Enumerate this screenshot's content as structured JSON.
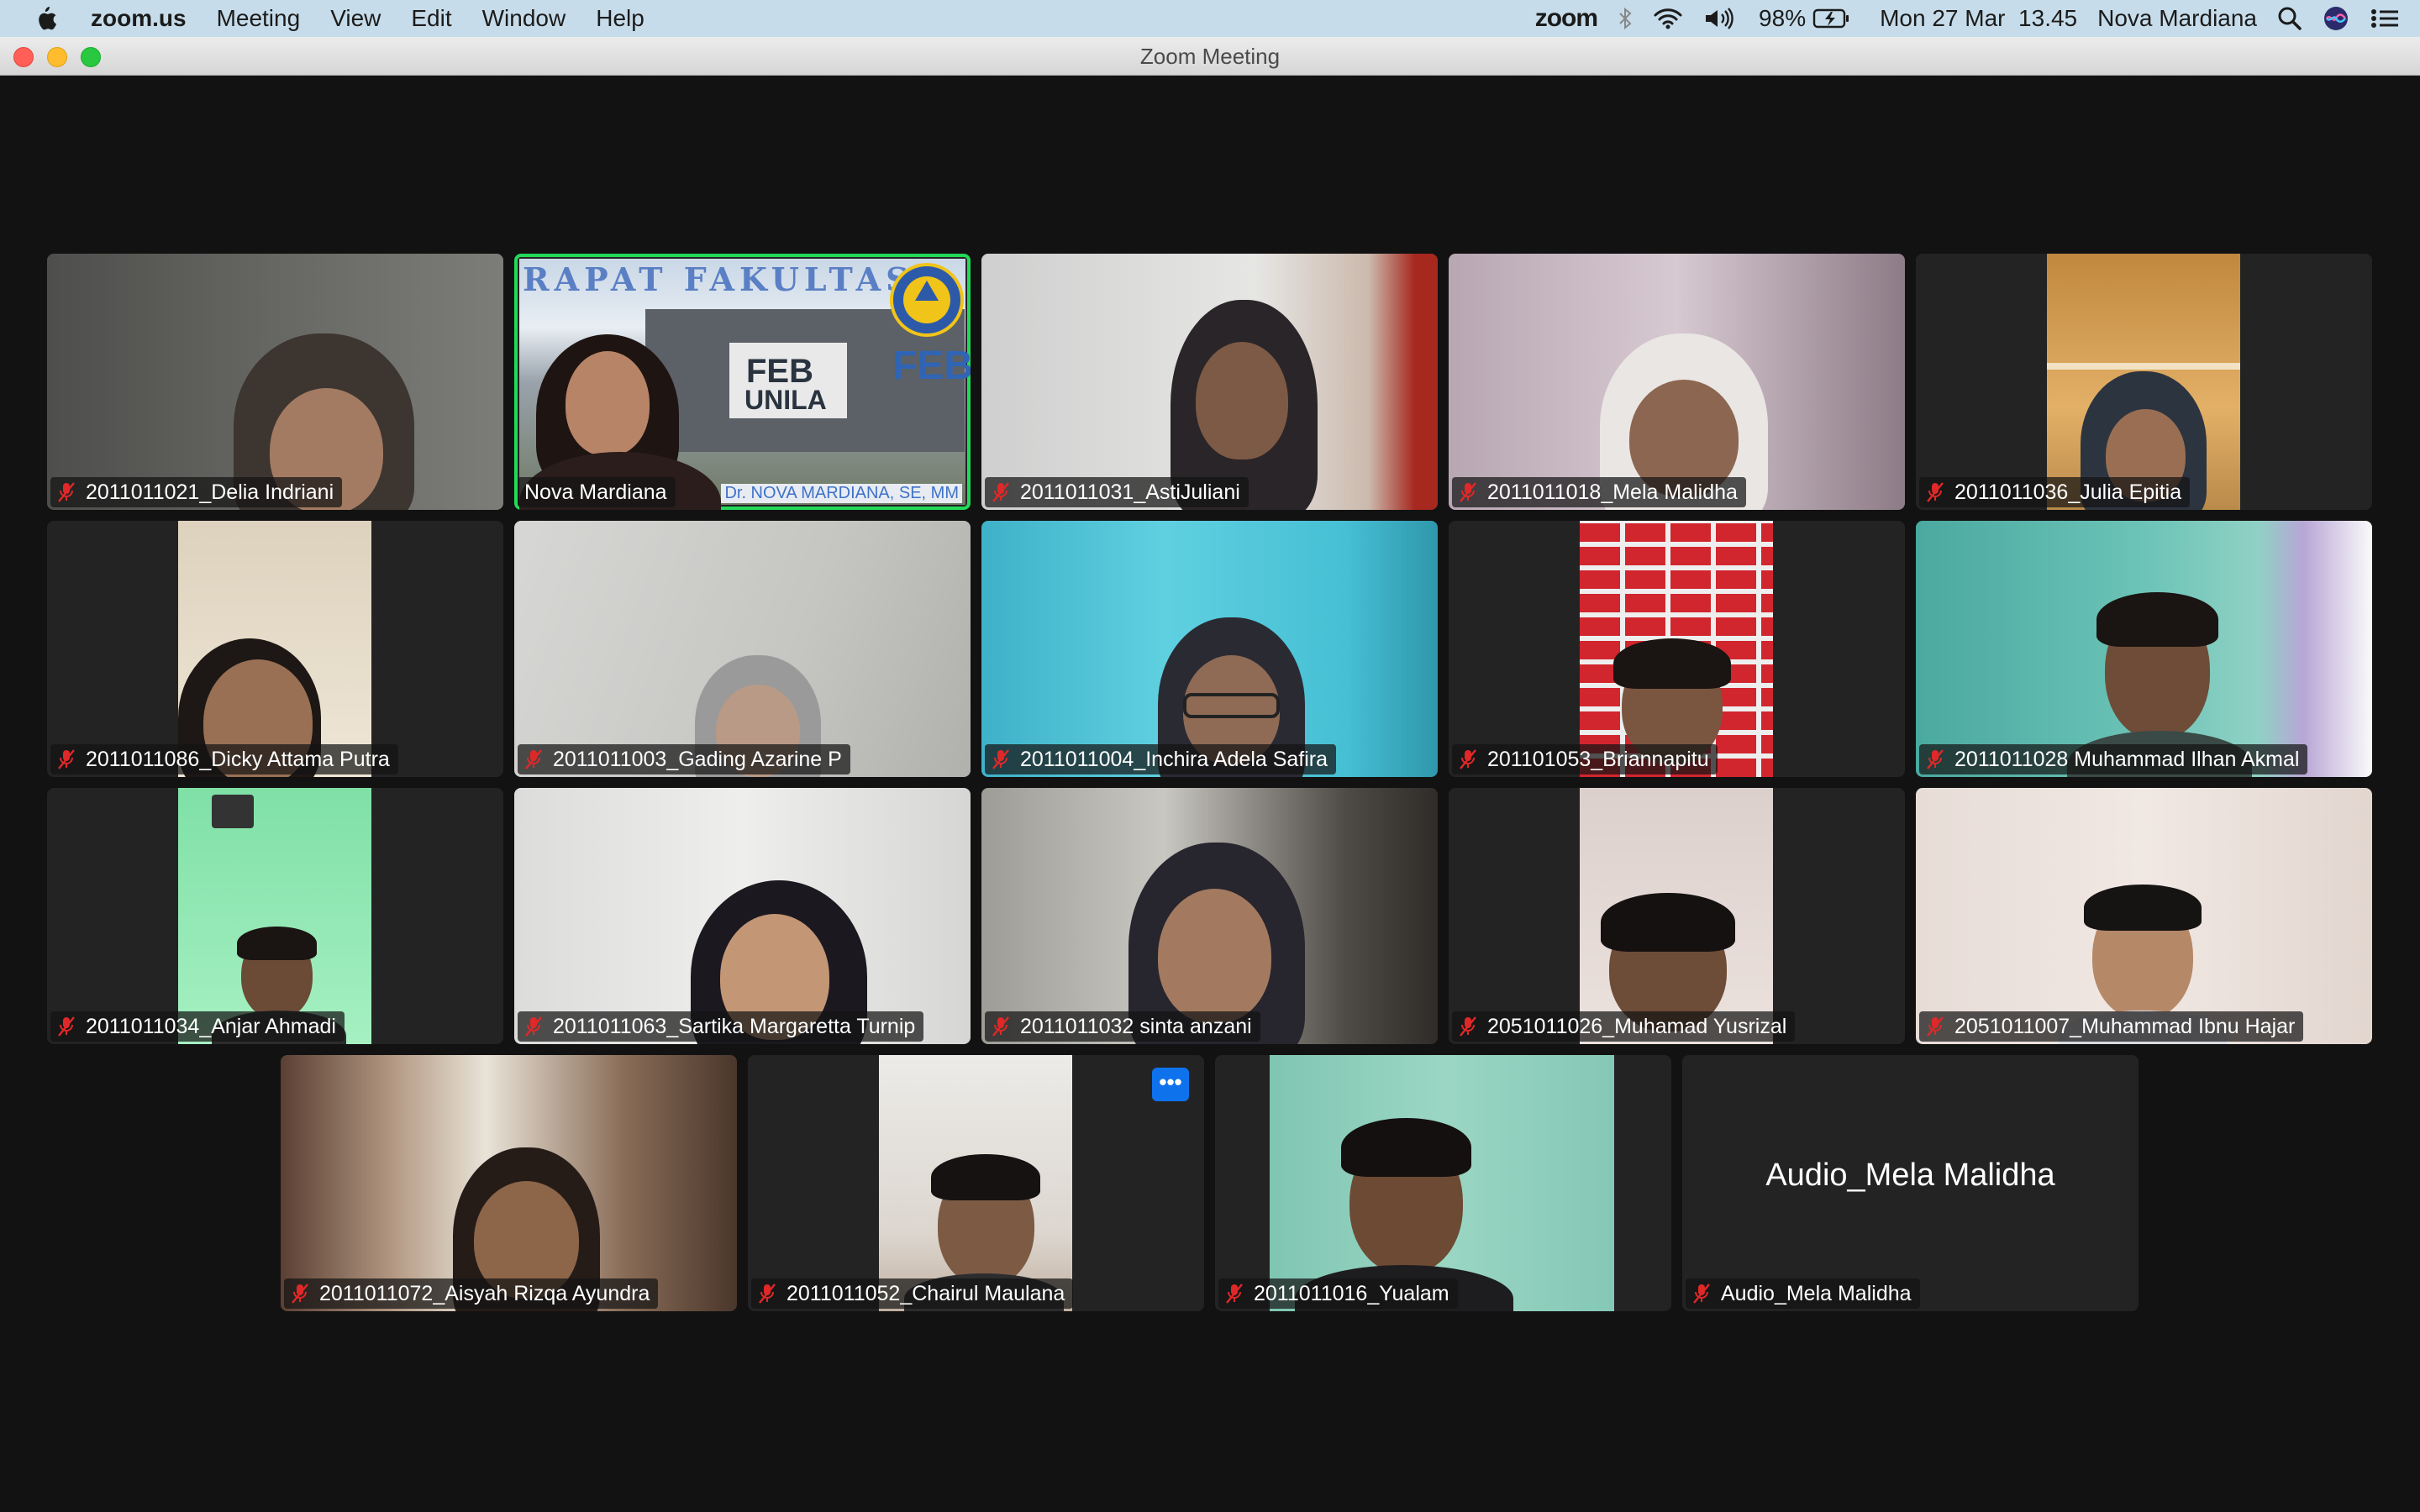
{
  "menubar": {
    "app_name": "zoom.us",
    "items": [
      "Meeting",
      "View",
      "Edit",
      "Window",
      "Help"
    ],
    "zoom_logo": "zoom",
    "battery": "98%",
    "datetime": "Mon 27 Mar  13.45",
    "user": "Nova Mardiana",
    "icons": [
      "apple-icon",
      "zoom-logo-icon",
      "bluetooth-icon",
      "wifi-icon",
      "volume-icon",
      "battery-icon",
      "spotlight-search-icon",
      "siri-icon",
      "control-center-icon"
    ]
  },
  "window": {
    "title": "Zoom Meeting",
    "traffic_lights": {
      "close": "#ff5f57",
      "minimize": "#febc2e",
      "zoom": "#28c840"
    }
  },
  "colors": {
    "active_speaker_border": "#23d959",
    "mute_icon": "#e02828",
    "more_button": "#0e72ed",
    "stage_bg": "#121212",
    "tile_bg": "#232323"
  },
  "participants": [
    {
      "name": "2011011021_Delia Indriani",
      "muted": true
    },
    {
      "name": "Nova Mardiana",
      "muted": false,
      "active_speaker": true,
      "banner": {
        "heading": "RAPAT FAKULTAS",
        "sign": [
          "FEB",
          "UNILA"
        ],
        "footer": "Dr. NOVA MARDIANA, SE, MM"
      }
    },
    {
      "name": "2011011031_AstiJuliani",
      "muted": true
    },
    {
      "name": "2011011018_Mela Malidha",
      "muted": true
    },
    {
      "name": "2011011036_Julia Epitia",
      "muted": true
    },
    {
      "name": "2011011086_Dicky Attama Putra",
      "muted": true
    },
    {
      "name": "2011011003_Gading Azarine P",
      "muted": true
    },
    {
      "name": "2011011004_Inchira Adela Safira",
      "muted": true
    },
    {
      "name": "201101053_Briannapitu",
      "muted": true
    },
    {
      "name": "2011011028 Muhammad Ilhan Akmal",
      "muted": true
    },
    {
      "name": "2011011034_Anjar Ahmadi",
      "muted": true
    },
    {
      "name": "2011011063_Sartika Margaretta Turnip",
      "muted": true
    },
    {
      "name": "2011011032 sinta anzani",
      "muted": true
    },
    {
      "name": "2051011026_Muhamad Yusrizal",
      "muted": true
    },
    {
      "name": "2051011007_Muhammad Ibnu Hajar",
      "muted": true
    },
    {
      "name": "2011011072_Aisyah Rizqa Ayundra",
      "muted": true
    },
    {
      "name": "2011011052_Chairul Maulana",
      "muted": true,
      "more_button": "•••"
    },
    {
      "name": "2011011016_Yualam",
      "muted": true
    },
    {
      "name": "Audio_Mela Malidha",
      "muted": true,
      "video_off": true,
      "center_label": "Audio_Mela Malidha"
    }
  ]
}
